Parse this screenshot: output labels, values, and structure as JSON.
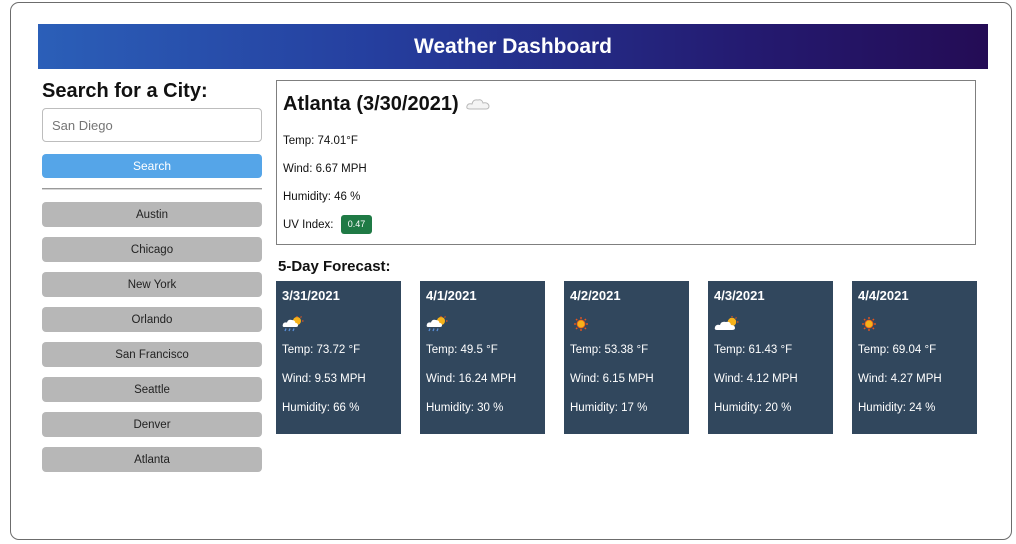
{
  "header": {
    "title": "Weather Dashboard"
  },
  "sidebar": {
    "heading": "Search for a City:",
    "search_placeholder": "San Diego",
    "search_button": "Search",
    "cities": [
      "Austin",
      "Chicago",
      "New York",
      "Orlando",
      "San Francisco",
      "Seattle",
      "Denver",
      "Atlanta"
    ]
  },
  "current": {
    "title": "Atlanta (3/30/2021)",
    "icon": "cloud-icon",
    "temp": "Temp: 74.01°F",
    "wind": "Wind: 6.67 MPH",
    "humidity": "Humidity: 46 %",
    "uv_label": "UV Index:",
    "uv_value": "0.47",
    "uv_color": "#1f7a45"
  },
  "forecast": {
    "title": "5-Day Forecast:",
    "days": [
      {
        "date": "3/31/2021",
        "icon": "rain-sun-icon",
        "temp": "Temp: 73.72 °F",
        "wind": "Wind: 9.53 MPH",
        "humidity": "Humidity: 66 %"
      },
      {
        "date": "4/1/2021",
        "icon": "rain-sun-icon",
        "temp": "Temp: 49.5 °F",
        "wind": "Wind: 16.24 MPH",
        "humidity": "Humidity: 30 %"
      },
      {
        "date": "4/2/2021",
        "icon": "sun-icon",
        "temp": "Temp: 53.38 °F",
        "wind": "Wind: 6.15 MPH",
        "humidity": "Humidity: 17 %"
      },
      {
        "date": "4/3/2021",
        "icon": "cloud-sun-icon",
        "temp": "Temp: 61.43 °F",
        "wind": "Wind: 4.12 MPH",
        "humidity": "Humidity: 20 %"
      },
      {
        "date": "4/4/2021",
        "icon": "sun-icon",
        "temp": "Temp: 69.04 °F",
        "wind": "Wind: 4.27 MPH",
        "humidity": "Humidity: 24 %"
      }
    ]
  },
  "colors": {
    "header_gradient_start": "#2b5fb8",
    "header_gradient_end": "#240c55",
    "search_button": "#55a5e8",
    "city_button": "#b7b7b7",
    "forecast_card": "#31475d"
  }
}
